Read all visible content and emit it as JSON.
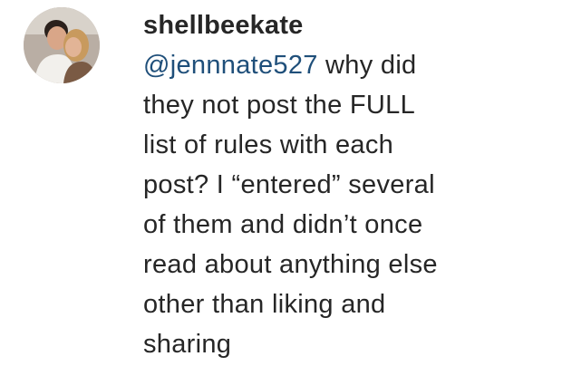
{
  "comment": {
    "username": "shellbeekate",
    "mention": "@jennnate527",
    "text_lines": [
      " why did",
      "they not post the FULL",
      "list of rules with each",
      "post? I “entered” several",
      "of them and didn’t once",
      "read about anything else",
      "other than liking and",
      "sharing"
    ]
  },
  "colors": {
    "text": "#262626",
    "mention": "#1f4f7a",
    "background": "#ffffff"
  }
}
